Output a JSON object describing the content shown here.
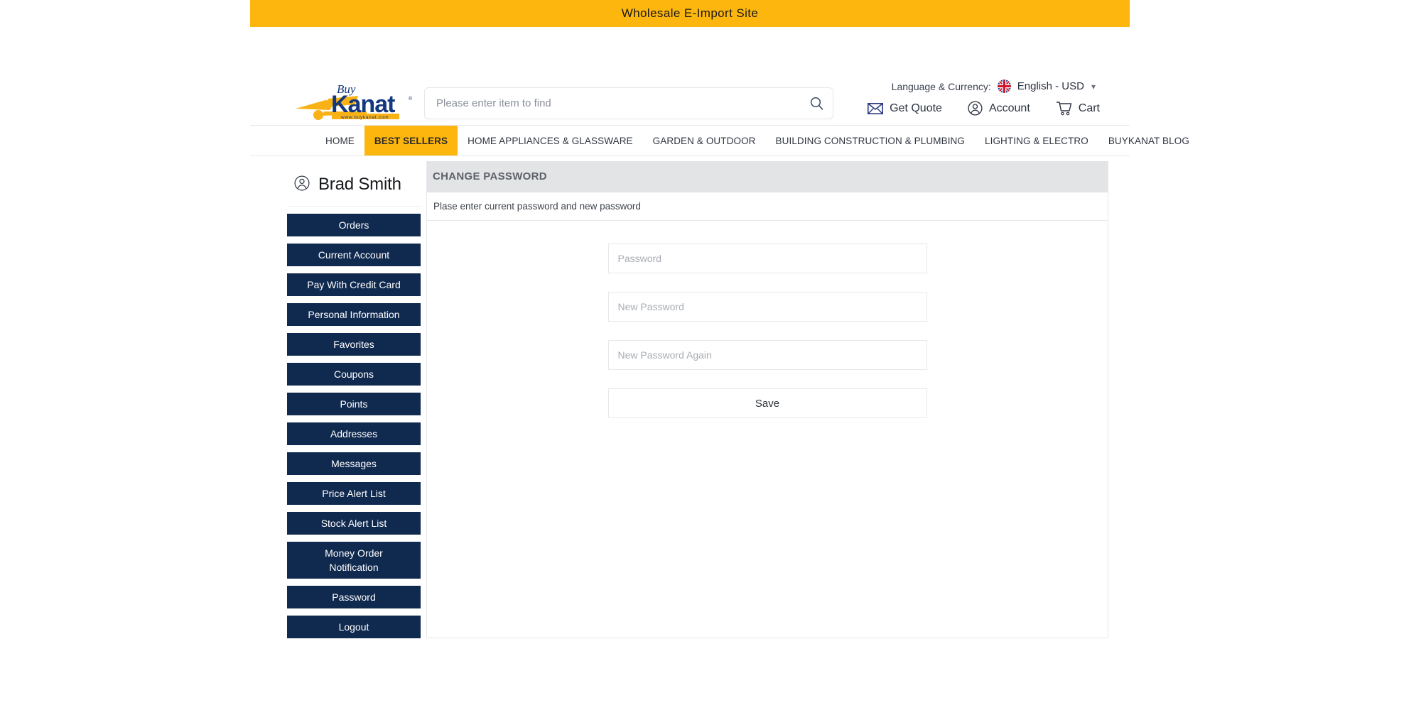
{
  "top_banner": {
    "text": "Wholesale E-Import Site",
    "bg_color": "#fdb60d"
  },
  "header": {
    "logo": {
      "name": "buykanat-logo",
      "script_word": "Buy",
      "main_word": "Kanat",
      "url_text": "www.buykanat.com",
      "brand_blue": "#13387e",
      "brand_yellow": "#f9b216"
    },
    "search": {
      "placeholder": "Please enter item to find",
      "value": "",
      "icon": "search-icon"
    },
    "language_currency": {
      "label": "Language & Currency:",
      "flag": "uk-flag-icon",
      "value": "English - USD",
      "chevron": "chevron-down-icon"
    },
    "actions": [
      {
        "icon": "envelope-icon",
        "label": "Get Quote"
      },
      {
        "icon": "user-circle-icon",
        "label": "Account"
      },
      {
        "icon": "shopping-cart-icon",
        "label": "Cart"
      }
    ]
  },
  "nav": {
    "items": [
      {
        "label": "HOME",
        "active": false
      },
      {
        "label": "BEST SELLERS",
        "active": true
      },
      {
        "label": "HOME APPLIANCES & GLASSWARE",
        "active": false
      },
      {
        "label": "GARDEN & OUTDOOR",
        "active": false
      },
      {
        "label": "BUILDING CONSTRUCTION & PLUMBING",
        "active": false
      },
      {
        "label": "LIGHTING & ELECTRO",
        "active": false
      },
      {
        "label": "BUYKANAT BLOG",
        "active": false
      }
    ],
    "active_bg": "#fdb60d"
  },
  "sidebar": {
    "user": {
      "icon": "user-circle-icon",
      "name": "Brad Smith"
    },
    "button_bg": "#10294f",
    "items": [
      {
        "label": "Orders",
        "two_line": false
      },
      {
        "label": "Current Account",
        "two_line": false
      },
      {
        "label": "Pay With Credit Card",
        "two_line": false
      },
      {
        "label": "Personal Information",
        "two_line": false
      },
      {
        "label": "Favorites",
        "two_line": false
      },
      {
        "label": "Coupons",
        "two_line": false
      },
      {
        "label": "Points",
        "two_line": false
      },
      {
        "label": "Addresses",
        "two_line": false
      },
      {
        "label": "Messages",
        "two_line": false
      },
      {
        "label": "Price Alert List",
        "two_line": false
      },
      {
        "label": "Stock Alert List",
        "two_line": false
      },
      {
        "label": "Money Order",
        "label2": "Notification",
        "two_line": true
      },
      {
        "label": "Password",
        "two_line": false
      },
      {
        "label": "Logout",
        "two_line": false
      }
    ]
  },
  "main": {
    "panel_title": "CHANGE PASSWORD",
    "panel_subtitle": "Plase enter current password and new password",
    "fields": [
      {
        "name": "current-password",
        "placeholder": "Password",
        "value": ""
      },
      {
        "name": "new-password",
        "placeholder": "New Password",
        "value": ""
      },
      {
        "name": "new-password-again",
        "placeholder": "New Password Again",
        "value": ""
      }
    ],
    "save_label": "Save",
    "header_bg": "#e3e4e6"
  }
}
